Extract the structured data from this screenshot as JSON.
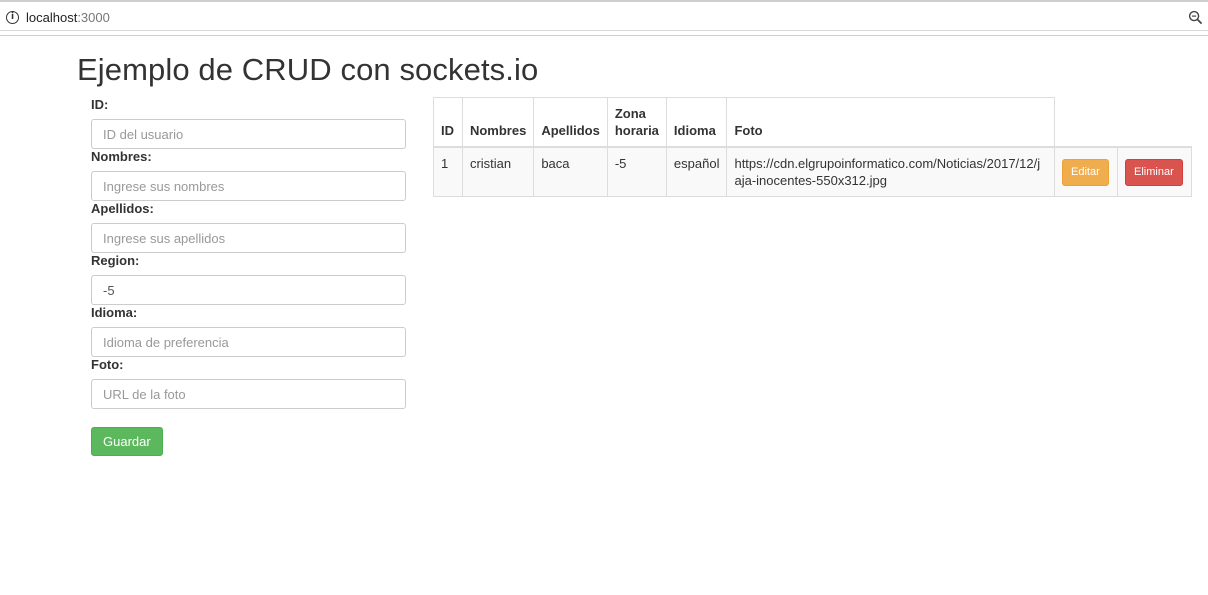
{
  "browser": {
    "url_host": "localhost",
    "url_port": ":3000",
    "icons": {
      "info": "info-icon",
      "zoom": "zoom-icon"
    }
  },
  "page": {
    "title": "Ejemplo de CRUD con sockets.io"
  },
  "form": {
    "fields": [
      {
        "label": "ID:",
        "placeholder": "ID del usuario",
        "value": ""
      },
      {
        "label": "Nombres:",
        "placeholder": "Ingrese sus nombres",
        "value": ""
      },
      {
        "label": "Apellidos:",
        "placeholder": "Ingrese sus apellidos",
        "value": ""
      },
      {
        "label": "Region:",
        "placeholder": "",
        "value": "-5"
      },
      {
        "label": "Idioma:",
        "placeholder": "Idioma de preferencia",
        "value": ""
      },
      {
        "label": "Foto:",
        "placeholder": "URL de la foto",
        "value": ""
      }
    ],
    "save_label": "Guardar"
  },
  "table": {
    "headers": [
      "ID",
      "Nombres",
      "Apellidos",
      "Zona horaria",
      "Idioma",
      "Foto"
    ],
    "rows": [
      {
        "id": "1",
        "nombres": "cristian",
        "apellidos": "baca",
        "zona": "-5",
        "idioma": "español",
        "foto": "https://cdn.elgrupoinformatico.com/Noticias/2017/12/jaja-inocentes-550x312.jpg",
        "edit_label": "Editar",
        "delete_label": "Eliminar"
      }
    ]
  },
  "colors": {
    "save": "#5cb85c",
    "edit": "#f0ad4e",
    "delete": "#d9534f"
  }
}
